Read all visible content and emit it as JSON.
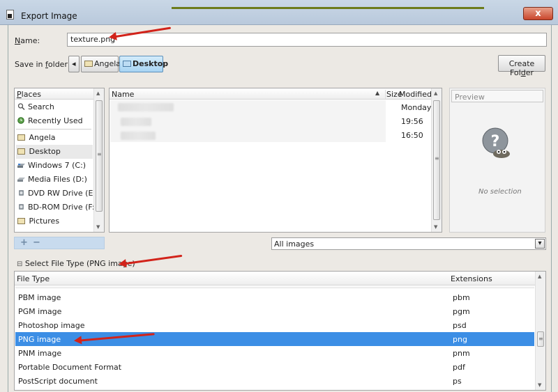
{
  "window": {
    "title": "Export Image",
    "close_label": "x"
  },
  "name_field": {
    "label_underlined": "N",
    "label_rest": "ame:",
    "value": "texture.png"
  },
  "save_in": {
    "label_pre": "Save in ",
    "label_underlined": "f",
    "label_rest": "older:",
    "back_glyph": "◂",
    "crumbs": [
      {
        "label": "Angela"
      },
      {
        "label": "Desktop"
      }
    ]
  },
  "create_folder": {
    "label_pre": "Create Fol",
    "label_underlined": "d",
    "label_rest": "er"
  },
  "places": {
    "header_underlined": "P",
    "header_rest": "laces",
    "items": [
      {
        "label": "Search",
        "icon": "magnifier-icon"
      },
      {
        "label": "Recently Used",
        "icon": "clock-icon"
      },
      {
        "label": "Angela",
        "icon": "folder-icon"
      },
      {
        "label": "Desktop",
        "icon": "folder-icon"
      },
      {
        "label": "Windows 7 (C:)",
        "icon": "drive-icon"
      },
      {
        "label": "Media Files (D:)",
        "icon": "drive-icon"
      },
      {
        "label": "DVD RW Drive (E:)",
        "icon": "optical-drive-icon"
      },
      {
        "label": "BD-ROM Drive (F:...",
        "icon": "optical-drive-icon"
      },
      {
        "label": "Pictures",
        "icon": "folder-icon"
      }
    ],
    "add_glyph": "+",
    "remove_glyph": "−"
  },
  "files": {
    "col_name": "Name",
    "sort_glyph": "▲",
    "col_size": "Size",
    "col_modified": "Modified",
    "rows": [
      {
        "modified": "Monday"
      },
      {
        "modified": "19:56"
      },
      {
        "modified": "16:50"
      }
    ]
  },
  "preview": {
    "header": "Preview",
    "empty": "No selection"
  },
  "filter": {
    "value": "All images",
    "dropdown_glyph": "▾"
  },
  "file_type": {
    "expander_glyph": "⊟",
    "label": "Select File Type (PNG image)",
    "col_type": "File Type",
    "col_ext": "Extensions",
    "rows": [
      {
        "type": "PBM image",
        "ext": "pbm"
      },
      {
        "type": "PGM image",
        "ext": "pgm"
      },
      {
        "type": "Photoshop image",
        "ext": "psd"
      },
      {
        "type": "PNG image",
        "ext": "png"
      },
      {
        "type": "PNM image",
        "ext": "pnm"
      },
      {
        "type": "Portable Document Format",
        "ext": "pdf"
      },
      {
        "type": "PostScript document",
        "ext": "ps"
      }
    ]
  },
  "scroll_glyphs": {
    "up": "▲",
    "down": "▼",
    "grip": "≡"
  },
  "colors": {
    "selection": "#3c8ee5",
    "annotation_arrow": "#d2231a",
    "active_crumb": "#a8d4f3"
  }
}
